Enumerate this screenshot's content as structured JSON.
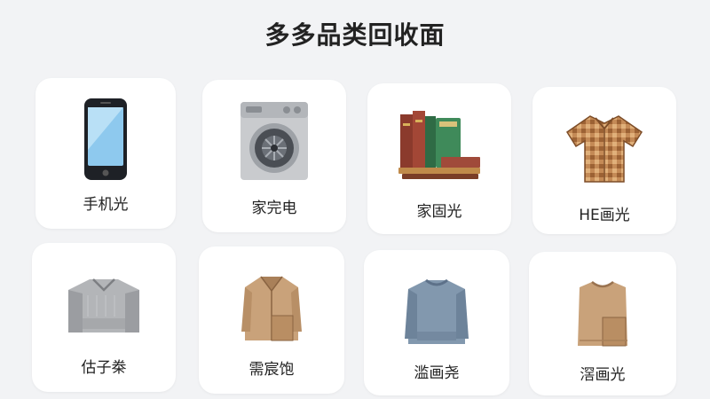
{
  "header": {
    "title": "多多品类回收面"
  },
  "categories": [
    {
      "label": "手机光",
      "icon": "smartphone-icon"
    },
    {
      "label": "家完电",
      "icon": "washing-machine-icon"
    },
    {
      "label": "家固光",
      "icon": "books-icon"
    },
    {
      "label": "HE画光",
      "icon": "shirt-icon"
    },
    {
      "label": "估子桊",
      "icon": "sweater-icon"
    },
    {
      "label": "需宸饱",
      "icon": "jacket-icon"
    },
    {
      "label": "滥画尧",
      "icon": "blue-sweater-icon"
    },
    {
      "label": "滘画光",
      "icon": "vest-icon"
    }
  ],
  "colors": {
    "background": "#f2f3f5",
    "card": "#ffffff",
    "text": "#222222"
  }
}
